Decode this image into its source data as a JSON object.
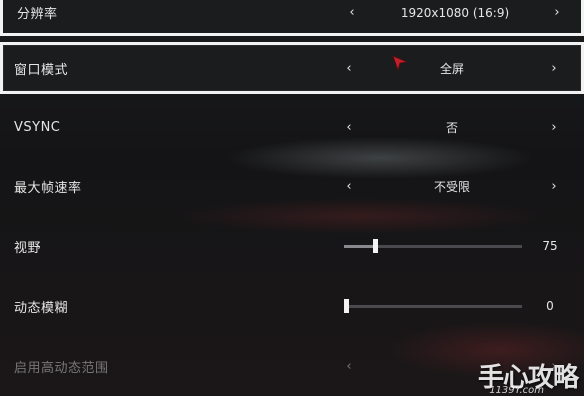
{
  "settings": {
    "resolution": {
      "label": "分辨率",
      "value": "1920x1080 (16:9)"
    },
    "window_mode": {
      "label": "窗口模式",
      "value": "全屏"
    },
    "vsync": {
      "label": "VSYNC",
      "value": "否"
    },
    "max_fps": {
      "label": "最大帧速率",
      "value": "不受限"
    },
    "fov": {
      "label": "视野",
      "value": "75",
      "fraction": 0.17
    },
    "motion_blur": {
      "label": "动态模糊",
      "value": "0",
      "fraction": 0.0
    },
    "hdr": {
      "label": "启用高动态范围"
    }
  },
  "icons": {
    "left": "‹",
    "right": "›",
    "cursor": "red-arrow-cursor-icon"
  },
  "colors": {
    "accent_cursor": "#c0202a",
    "selection_border": "#f2f2f2"
  },
  "watermark": {
    "main": "手心攻略",
    "sub": "1139Y.com"
  }
}
